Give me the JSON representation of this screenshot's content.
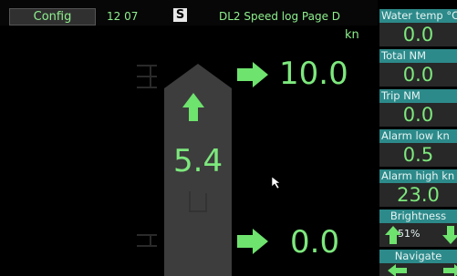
{
  "header": {
    "config_label": "Config",
    "time": "12 07",
    "logo_letter": "S",
    "title": "DL2 Speed log Page D",
    "unit": "kn"
  },
  "speeds": {
    "center": "5.4",
    "top": "10.0",
    "bottom": "0.0"
  },
  "side_panels": {
    "water_temp": {
      "label": "Water temp °C",
      "value": "0.0"
    },
    "total_nm": {
      "label": "Total NM",
      "value": "0.0"
    },
    "trip_nm": {
      "label": "Trip NM",
      "value": "0.0"
    },
    "alarm_low": {
      "label": "Alarm low kn",
      "value": "0.5"
    },
    "alarm_high": {
      "label": "Alarm high kn",
      "value": "23.0"
    },
    "brightness": {
      "label": "Brightness",
      "value": "51%"
    },
    "navigate": {
      "label": "Navigate"
    }
  },
  "colors": {
    "accent_green": "#7de87d",
    "panel_teal": "#2d8a8a",
    "ship_grey": "#3d3d3d"
  }
}
